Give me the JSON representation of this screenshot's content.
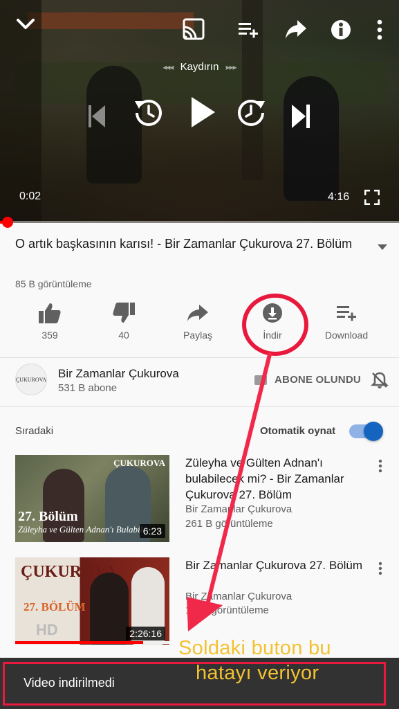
{
  "player": {
    "seek_hint": "Kaydırın",
    "current_time": "0:02",
    "total_time": "4:16",
    "progress_fraction": 0.008
  },
  "video": {
    "title": "O artık başkasının karısı! - Bir Zamanlar Çukurova 27. Bölüm",
    "views": "85 B görüntüleme"
  },
  "actions": {
    "like_count": "359",
    "dislike_count": "40",
    "share_label": "Paylaş",
    "download_label": "İndir",
    "add_label": "Download"
  },
  "channel": {
    "avatar_text": "ÇUKUROVA",
    "name": "Bir Zamanlar Çukurova",
    "subscribers": "531 B abone",
    "subscribed_label": "ABONE OLUNDU"
  },
  "upnext": {
    "heading": "Sıradaki",
    "autoplay_label": "Otomatik oynat",
    "autoplay_on": true,
    "items": [
      {
        "title": "Züleyha ve Gülten Adnan'ı bulabilecek mi? - Bir Zamanlar Çukurova 27. Bölüm",
        "channel": "Bir Zamanlar Çukurova",
        "views": "261 B görüntüleme",
        "duration": "6:23",
        "thumb_episode": "27. Bölüm",
        "thumb_caption": "Züleyha ve Gülten Adnan'ı Bulabil",
        "thumb_brand": "ÇUKUROVA"
      },
      {
        "title": "Bir Zamanlar Çukurova 27. Bölüm",
        "channel": "Bir Zamanlar Çukurova",
        "views": "1 Mn görüntüleme",
        "duration": "2:26:16",
        "thumb_episode": "27. BÖLÜM",
        "thumb_caption": "HD",
        "thumb_brand": "ÇUKUROVA",
        "watched_fraction": 0.83
      }
    ]
  },
  "snackbar": {
    "message": "Video indirilmedi"
  },
  "annotation": {
    "line1": "Soldaki buton bu",
    "line2": "hatayı veriyor",
    "color": "#f2c230",
    "highlight_color": "#e8193c"
  }
}
